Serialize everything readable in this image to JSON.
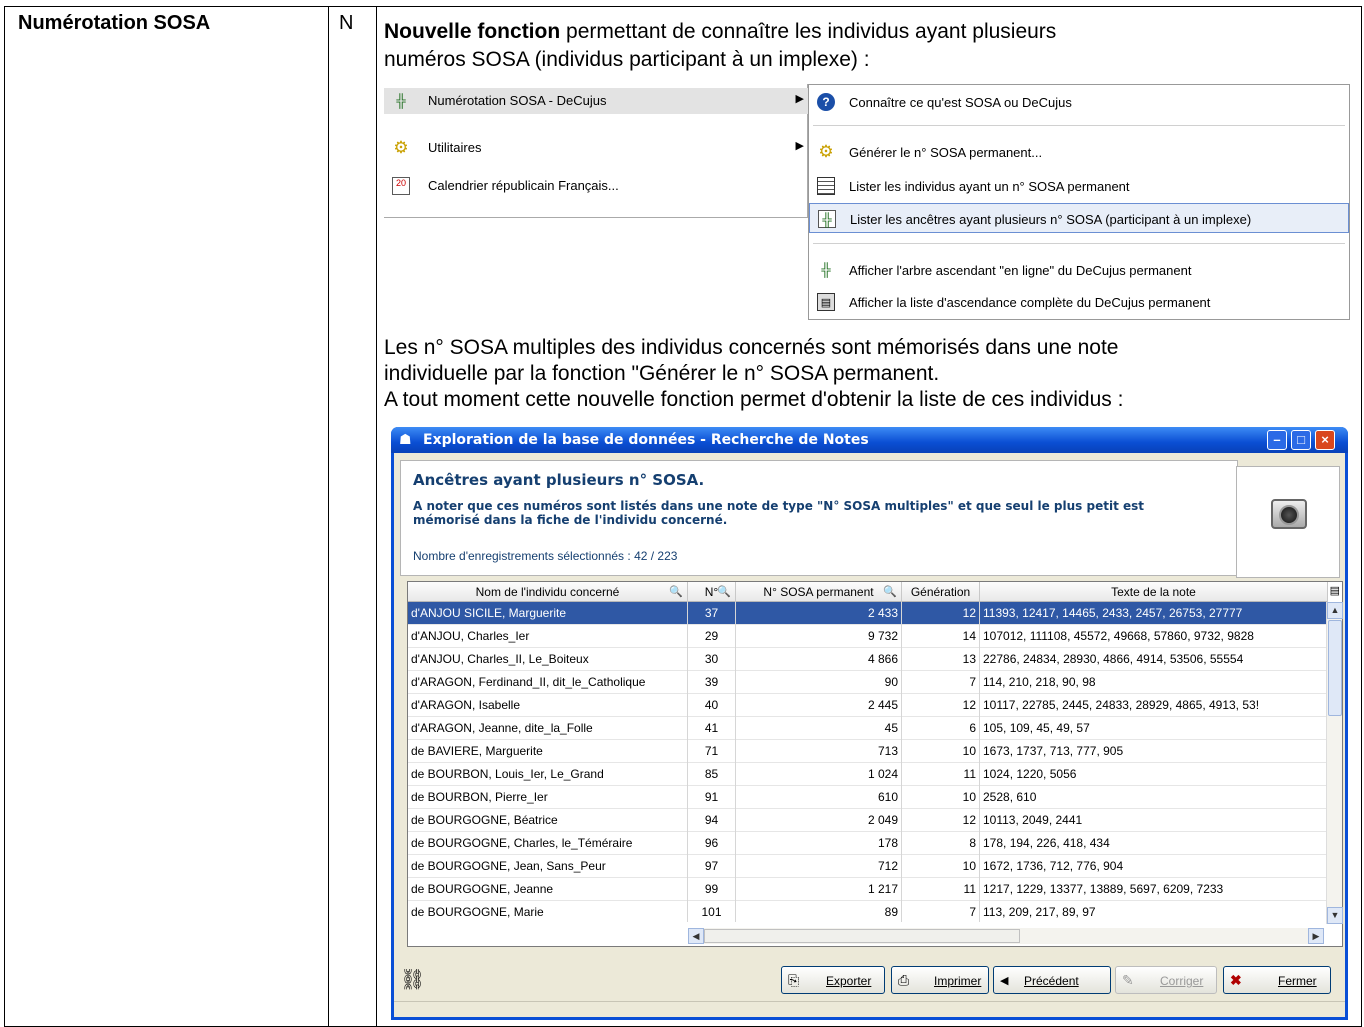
{
  "feature": {
    "name": "Numérotation SOSA",
    "type": "N"
  },
  "intro": {
    "bold": "Nouvelle fonction",
    "line1_rest": " permettant de connaître les individus ayant plusieurs",
    "line2": "numéros SOSA (individus participant à un implexe) :"
  },
  "menu": {
    "items": [
      {
        "label": "Numérotation SOSA  -  DeCujus",
        "icon": "tree-icon"
      },
      {
        "label": "Utilitaires",
        "icon": "gear-icon"
      },
      {
        "label": "Calendrier républicain Français...",
        "icon": "calendar-icon"
      }
    ],
    "submenu": [
      {
        "label": "Connaître ce qu'est SOSA ou DeCujus",
        "icon": "help-icon"
      },
      {
        "label": "Générer le n° SOSA permanent...",
        "icon": "gear-icon"
      },
      {
        "label": "Lister les individus ayant un n° SOSA permanent",
        "icon": "list-icon"
      },
      {
        "label": "Lister les ancêtres ayant plusieurs n° SOSA (participant à un implexe)",
        "icon": "ancestors-icon"
      },
      {
        "label": "Afficher l'arbre ascendant \"en ligne\" du DeCujus permanent",
        "icon": "tree-icon"
      },
      {
        "label": "Afficher la liste d'ascendance complète du DeCujus permanent",
        "icon": "book-icon"
      }
    ]
  },
  "para2": {
    "line1": "Les n° SOSA multiples des individus concernés sont mémorisés dans une note",
    "line2": "individuelle par la fonction \"Générer le n° SOSA permanent.",
    "line3": "A tout moment cette nouvelle fonction permet d'obtenir la liste de ces individus :"
  },
  "window": {
    "title": "Exploration de la base de données - Recherche de Notes",
    "panel_title": "Ancêtres ayant plusieurs n° SOSA.",
    "note": "A noter que ces numéros sont listés dans une note de type \"N° SOSA multiples\" et que seul le plus petit est mémorisé dans la fiche de l'individu concerné.",
    "count": "Nombre d'enregistrements sélectionnés : 42 / 223",
    "columns": [
      "Nom de l'individu concerné",
      "N°",
      "N° SOSA permanent",
      "Génération",
      "Texte de la note"
    ],
    "rows": [
      [
        "d'ANJOU SICILE, Marguerite",
        "37",
        "2 433",
        "12",
        "11393, 12417, 14465, 2433, 2457, 26753, 27777"
      ],
      [
        "d'ANJOU, Charles_Ier",
        "29",
        "9 732",
        "14",
        "107012, 111108, 45572, 49668, 57860, 9732, 9828"
      ],
      [
        "d'ANJOU, Charles_II, Le_Boiteux",
        "30",
        "4 866",
        "13",
        "22786, 24834, 28930, 4866, 4914, 53506, 55554"
      ],
      [
        "d'ARAGON, Ferdinand_II, dit_le_Catholique",
        "39",
        "90",
        "7",
        "114, 210, 218, 90, 98"
      ],
      [
        "d'ARAGON, Isabelle",
        "40",
        "2 445",
        "12",
        "10117, 22785, 2445, 24833, 28929, 4865, 4913, 53!"
      ],
      [
        "d'ARAGON, Jeanne, dite_la_Folle",
        "41",
        "45",
        "6",
        "105, 109, 45, 49, 57"
      ],
      [
        "de BAVIERE, Marguerite",
        "71",
        "713",
        "10",
        "1673, 1737, 713, 777, 905"
      ],
      [
        "de BOURBON, Louis_Ier, Le_Grand",
        "85",
        "1 024",
        "11",
        "1024, 1220, 5056"
      ],
      [
        "de BOURBON, Pierre_Ier",
        "91",
        "610",
        "10",
        "2528, 610"
      ],
      [
        "de BOURGOGNE, Béatrice",
        "94",
        "2 049",
        "12",
        "10113, 2049, 2441"
      ],
      [
        "de BOURGOGNE, Charles, le_Téméraire",
        "96",
        "178",
        "8",
        "178, 194, 226, 418, 434"
      ],
      [
        "de BOURGOGNE, Jean, Sans_Peur",
        "97",
        "712",
        "10",
        "1672, 1736, 712, 776, 904"
      ],
      [
        "de BOURGOGNE, Jeanne",
        "99",
        "1 217",
        "11",
        "1217, 1229, 13377, 13889, 5697, 6209, 7233"
      ],
      [
        "de BOURGOGNE, Marie",
        "101",
        "89",
        "7",
        "113, 209, 217, 89, 97"
      ]
    ],
    "buttons": {
      "export": "Exporter",
      "print": "Imprimer",
      "prev": "Précédent",
      "edit": "Corriger",
      "close": "Fermer"
    }
  }
}
